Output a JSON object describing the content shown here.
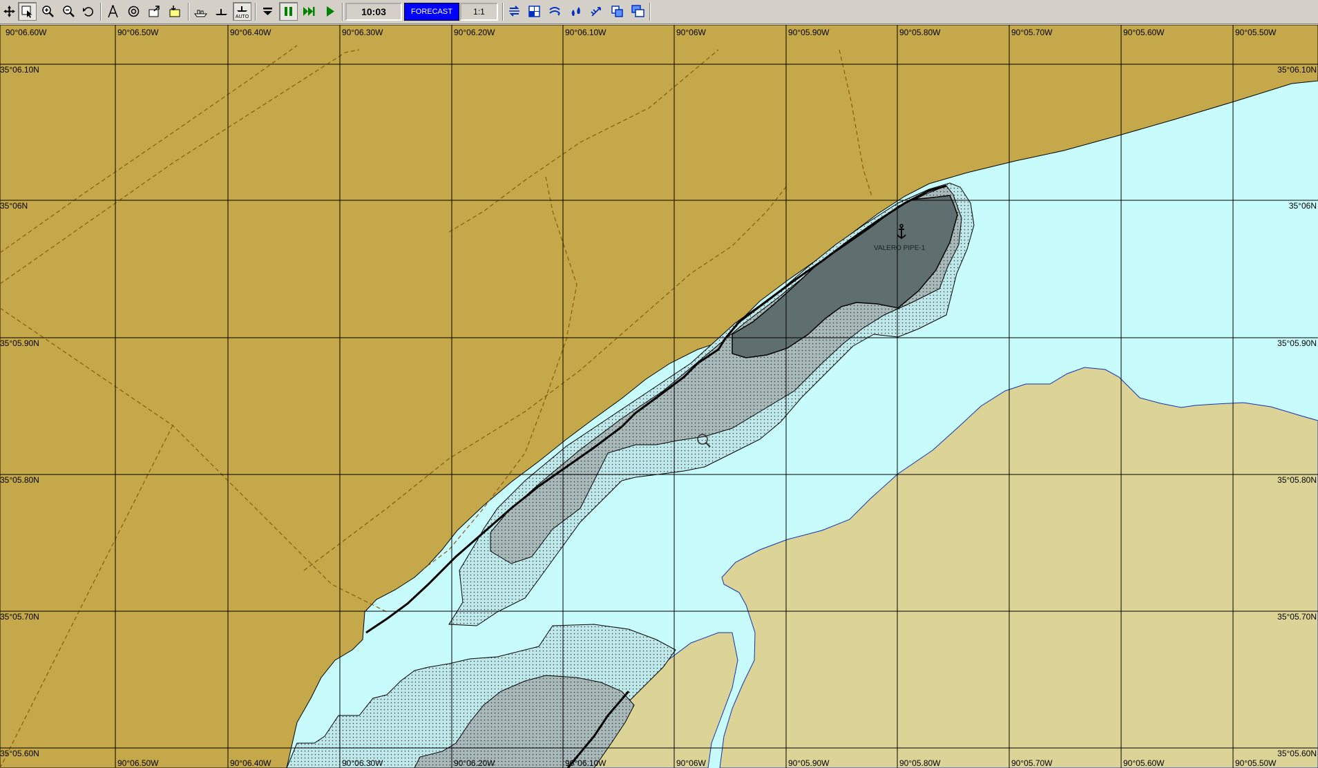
{
  "toolbar": {
    "time": "10:03",
    "forecast_label": "FORECAST",
    "scale": "1:1",
    "auto_label": "AUTO",
    "icons": [
      "pan-icon",
      "select-icon",
      "zoom-in-icon",
      "zoom-out-icon",
      "undo-icon",
      "route-icon",
      "center-icon",
      "export-icon",
      "import-icon",
      "ship-icon",
      "vessel-icon",
      "auto-icon",
      "collapse-icon",
      "pause-icon",
      "fast-forward-icon",
      "play-icon",
      "swap-icon",
      "grid-icon",
      "current-icon",
      "bathymetry-icon",
      "wind-icon",
      "layers-icon",
      "windows-icon"
    ]
  },
  "map": {
    "top_longitudes": [
      "90°06.60W",
      "90°06.50W",
      "90°06.40W",
      "90°06.30W",
      "90°06.20W",
      "90°06.10W",
      "90°06W",
      "90°05.90W",
      "90°05.80W",
      "90°05.70W",
      "90°05.60W",
      "90°05.50W"
    ],
    "bottom_longitudes": [
      "90°06.50W",
      "90°06.40W",
      "90°06.30W",
      "90°06.20W",
      "90°06.10W",
      "90°06W",
      "90°05.90W",
      "90°05.80W",
      "90°05.70W",
      "90°05.60W",
      "90°05.50W"
    ],
    "latitudes": [
      "35°06.10N",
      "35°06N",
      "35°05.90N",
      "35°05.80N",
      "35°05.70N",
      "35°05.60N"
    ],
    "latitudes_left": [
      "35°06.10N",
      "35°06N",
      "35°05.90N",
      "35°05.80N",
      "35°05.70N",
      "35°05.60N"
    ],
    "feature_label": "VALERO PIPE-1",
    "colors": {
      "land": "#c4a84a",
      "water": "#c8fbfb",
      "sandbar": "#dcd396",
      "deep_dark": "#5f6e6e",
      "shallow_gray": "#a9b8b8",
      "grid": "#000000",
      "track": "#8a5a10"
    }
  }
}
